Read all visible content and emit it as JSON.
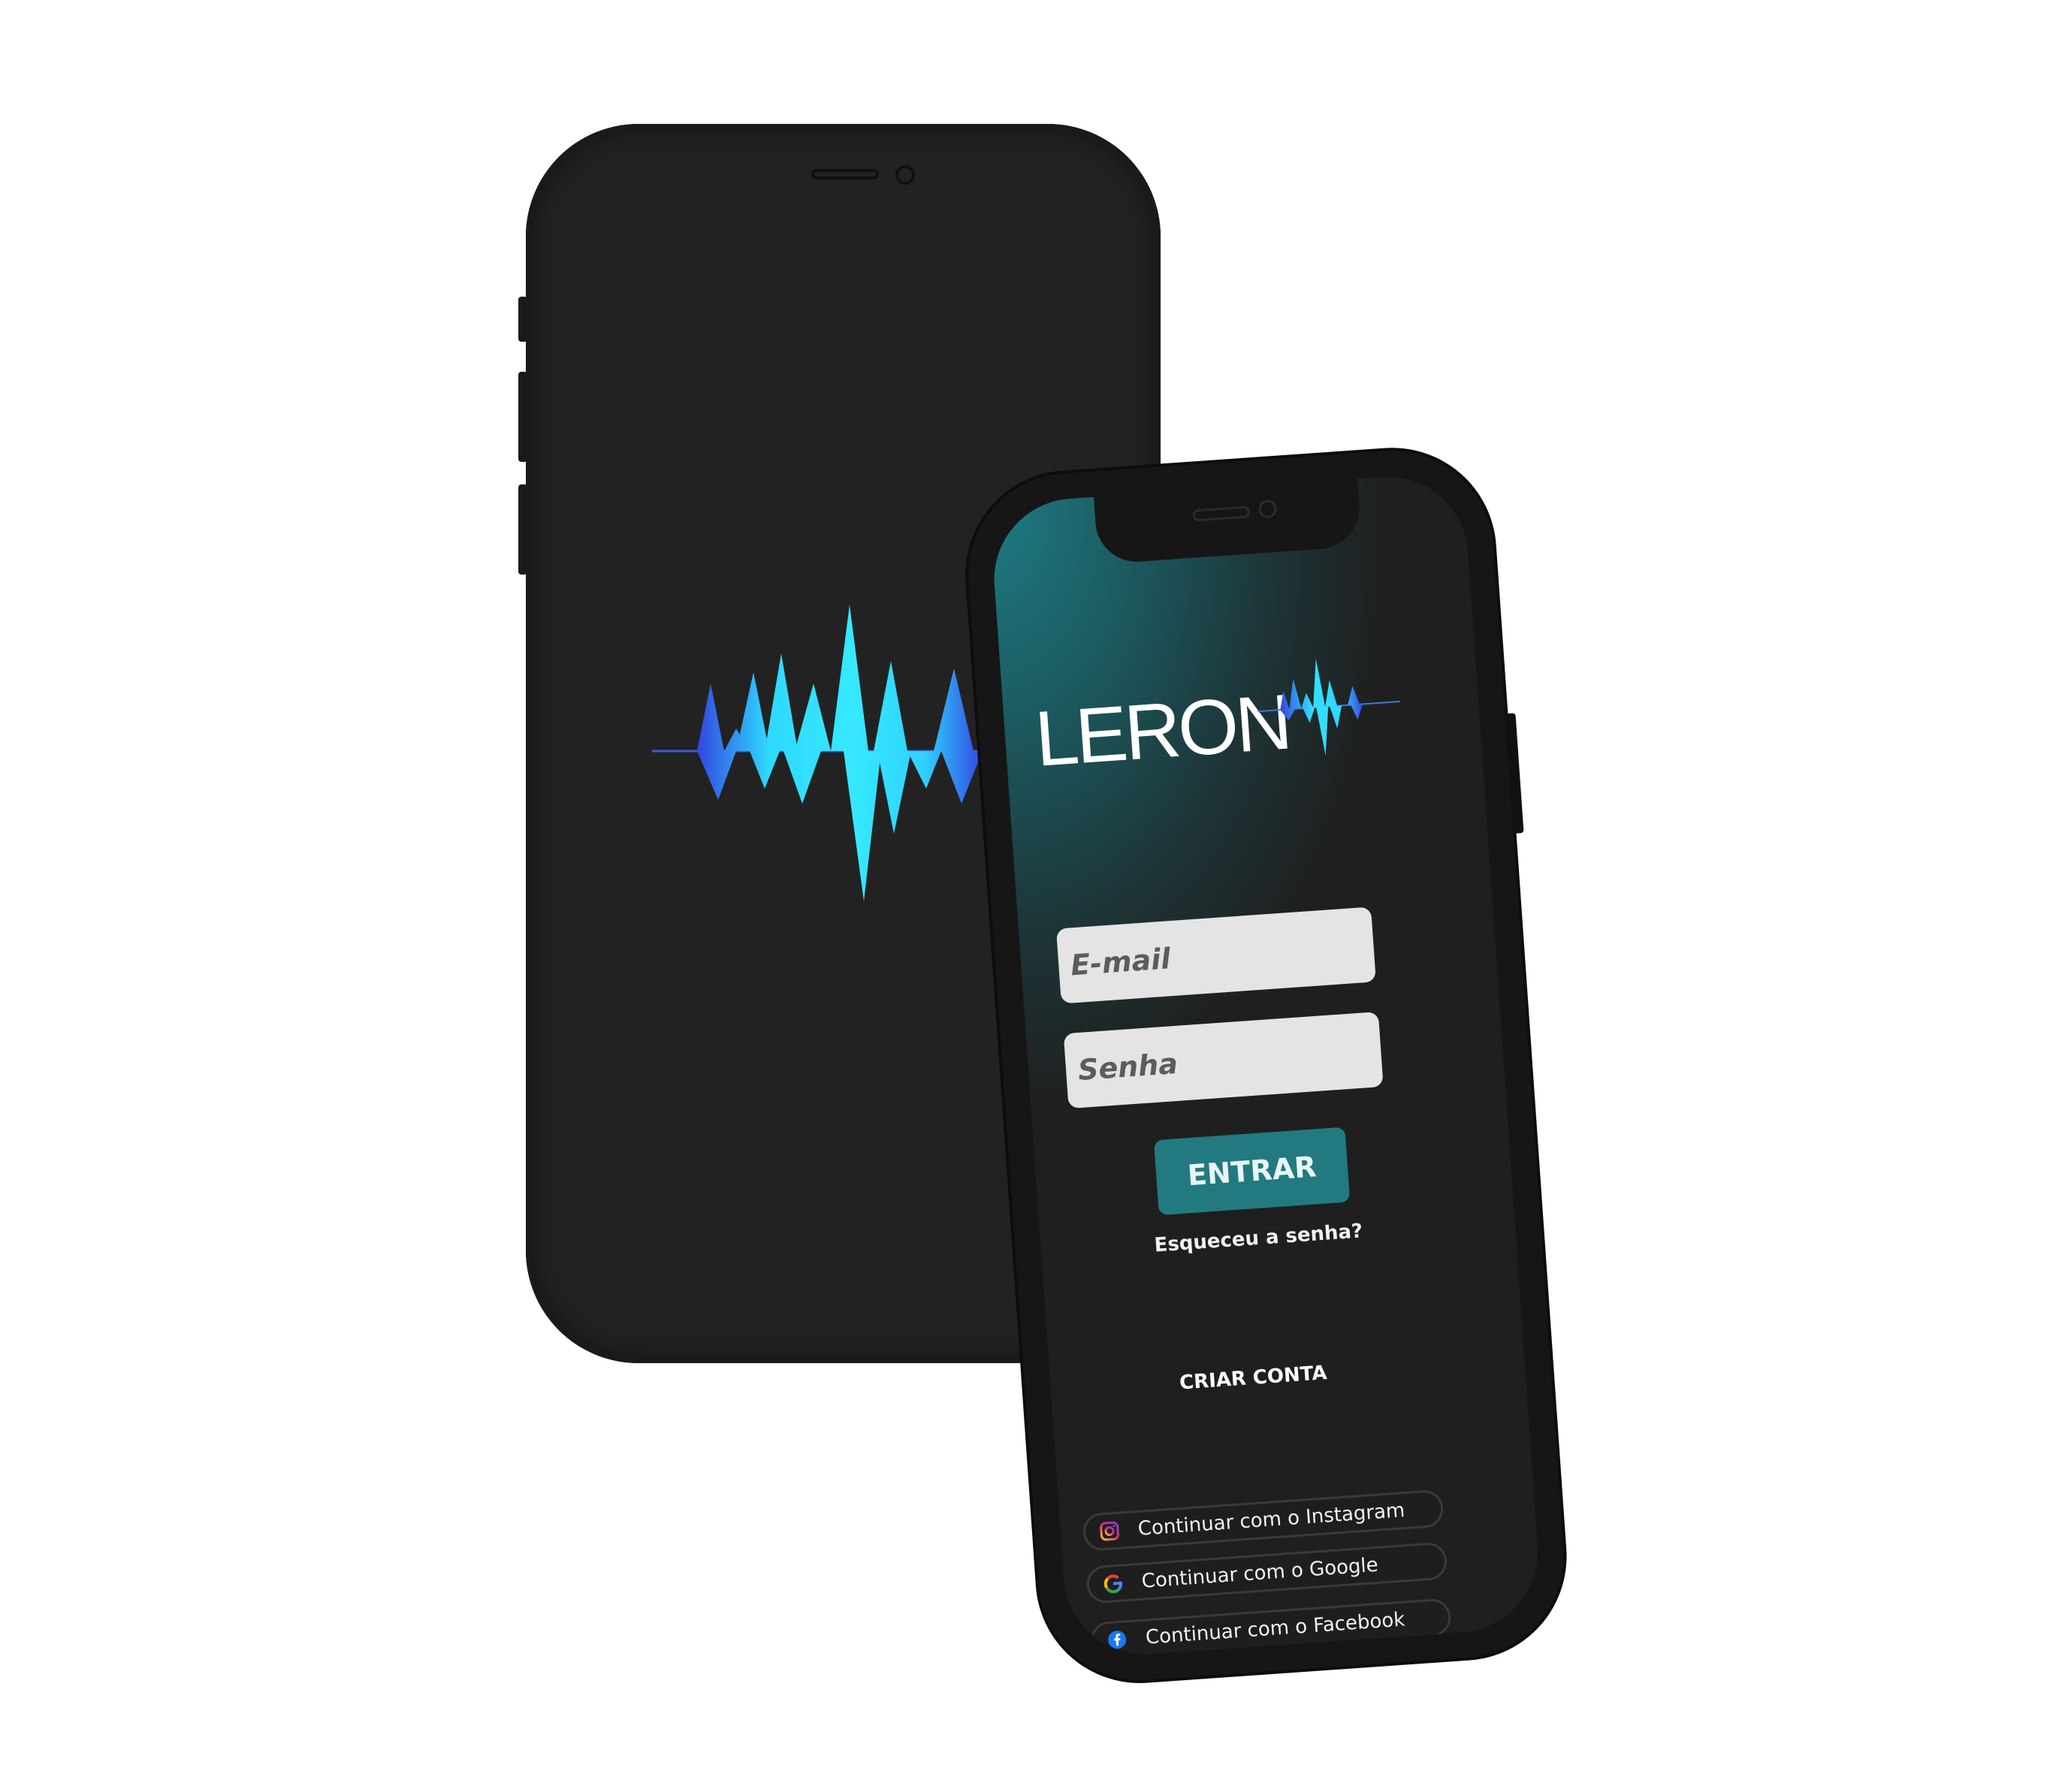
{
  "splash_phone": {
    "logo_icon": "sound-wave-icon"
  },
  "login_phone": {
    "brand": "LERON",
    "logo_icon": "sound-wave-icon",
    "email_placeholder": "E-mail",
    "password_placeholder": "Senha",
    "login_button": "ENTRAR",
    "forgot_password": "Esqueceu a senha?",
    "create_account": "CRIAR CONTA",
    "social": [
      {
        "label": "Continuar com o Instagram",
        "icon": "instagram-icon"
      },
      {
        "label": "Continuar com o Google",
        "icon": "google-icon"
      },
      {
        "label": "Continuar com o Facebook",
        "icon": "facebook-icon"
      }
    ]
  },
  "colors": {
    "accent": "#227a80",
    "wave_light": "#2fe6ff",
    "wave_dark": "#3346e0",
    "phone_body": "#222222"
  }
}
